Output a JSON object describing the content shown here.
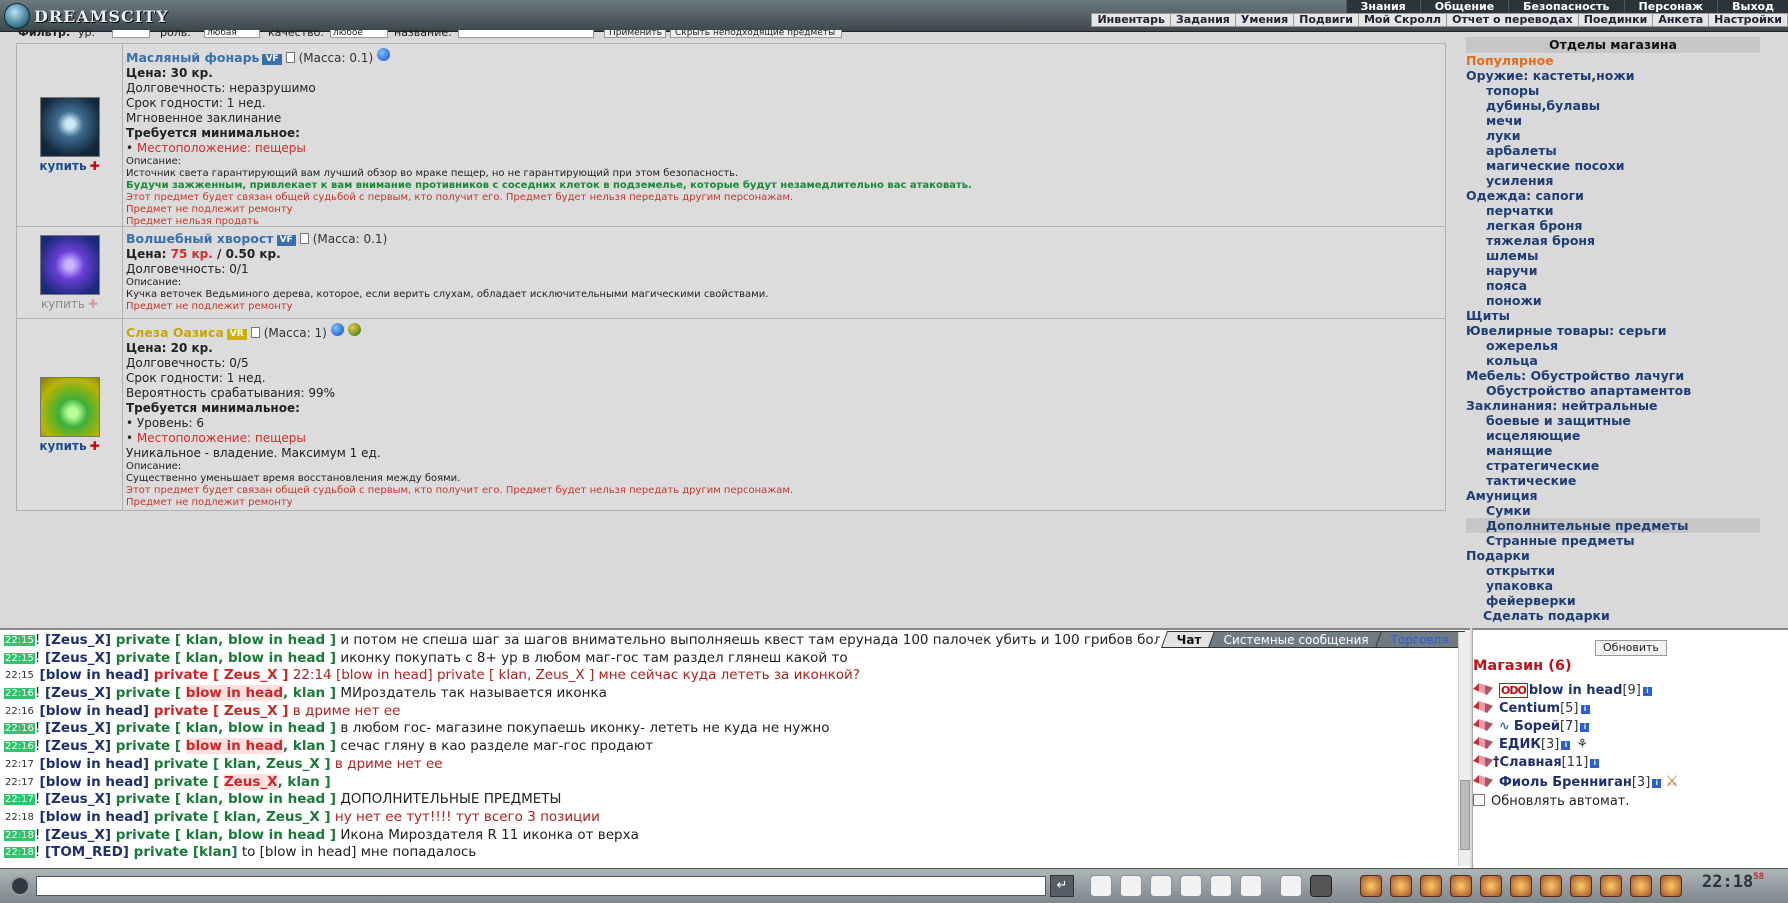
{
  "logo": "DREAMSCITY",
  "main_menu": [
    "Знания",
    "Общение",
    "Безопасность",
    "Персонаж",
    "Выход"
  ],
  "sub_menu": [
    "Инвентарь",
    "Задания",
    "Умения",
    "Подвиги",
    "Мой Скролл",
    "Отчет о переводах",
    "Поединки",
    "Анкета",
    "Настройки"
  ],
  "filter": {
    "fragments": [
      "Фильтр:",
      "ур.",
      "роль:",
      "качество:",
      "название:"
    ],
    "role_value": "любая",
    "quality_value": "любое",
    "apply": "Применить",
    "hide": "Скрыть неподходящие предметы"
  },
  "items": [
    {
      "name": "Масляный фонарь",
      "badge": "VF",
      "mass": "(Масса: 0.1)",
      "price_label": "Цена:",
      "price": "30 кр.",
      "lines": [
        "Долговечность: неразрушимо",
        "Срок годности: 1 нед.",
        "Мгновенное заклинание"
      ],
      "req_title": "Требуется минимальное:",
      "req": [
        "Местоположение: пещеры"
      ],
      "desc_label": "Описание:",
      "desc": "Источник света гарантирующий вам лучший обзор во мраке пещер, но не гарантирующий при этом безопасность.",
      "green": "Будучи зажженным, привлекает к вам внимание противников с соседних клеток в подземелье, которые будут незамедлительно вас атаковать.",
      "warnings": [
        "Этот предмет будет связан общей судьбой с первым, кто получит его. Предмет будет нельзя передать другим персонажам.",
        "Предмет не подлежит ремонту",
        "Предмет нельзя продать"
      ],
      "buy": "купить"
    },
    {
      "name": "Волшебный хворост",
      "badge": "VF",
      "mass": "(Масса: 0.1)",
      "price_label": "Цена:",
      "price_red": "75 кр.",
      "price_extra": "/ 0.50 кр.",
      "lines": [
        "Долговечность: 0/1"
      ],
      "desc_label": "Описание:",
      "desc": "Кучка веточек Ведьминого дерева, которое, если верить слухам, обладает исключительными магическими свойствами.",
      "warnings": [
        "Предмет не подлежит ремонту"
      ],
      "buy": "купить"
    },
    {
      "name": "Слеза Оазиса",
      "badge": "VR",
      "mass": "(Масса: 1)",
      "price_label": "Цена:",
      "price": "20 кр.",
      "lines": [
        "Долговечность: 0/5",
        "Срок годности: 1 нед.",
        "Вероятность срабатывания: 99%"
      ],
      "req_title": "Требуется минимальное:",
      "req_plain": "• Уровень: 6",
      "req": [
        "Местоположение: пещеры"
      ],
      "extra": "Уникальное - владение. Максимум 1 ед.",
      "desc_label": "Описание:",
      "desc": "Существенно уменьшает время восстановления между боями.",
      "warnings": [
        "Этот предмет будет связан общей судьбой с первым, кто получит его. Предмет будет нельзя передать другим персонажам.",
        "Предмет не подлежит ремонту"
      ],
      "buy": "купить"
    }
  ],
  "shop_sections": {
    "title": "Отделы магазина",
    "entries": [
      {
        "t": "cat pop",
        "l": "Популярное"
      },
      {
        "t": "cat",
        "l": "Оружие: кастеты,ножи"
      },
      {
        "t": "sub",
        "l": "топоры"
      },
      {
        "t": "sub",
        "l": "дубины,булавы"
      },
      {
        "t": "sub",
        "l": "мечи"
      },
      {
        "t": "sub",
        "l": "луки"
      },
      {
        "t": "sub",
        "l": "арбалеты"
      },
      {
        "t": "sub",
        "l": "магические посохи"
      },
      {
        "t": "sub",
        "l": "усиления"
      },
      {
        "t": "cat",
        "l": "Одежда: сапоги"
      },
      {
        "t": "sub",
        "l": "перчатки"
      },
      {
        "t": "sub",
        "l": "легкая броня"
      },
      {
        "t": "sub",
        "l": "тяжелая броня"
      },
      {
        "t": "sub",
        "l": "шлемы"
      },
      {
        "t": "sub",
        "l": "наручи"
      },
      {
        "t": "sub",
        "l": "пояса"
      },
      {
        "t": "sub",
        "l": "поножи"
      },
      {
        "t": "cat",
        "l": "Щиты"
      },
      {
        "t": "cat",
        "l": "Ювелирные товары: серьги"
      },
      {
        "t": "sub",
        "l": "ожерелья"
      },
      {
        "t": "sub",
        "l": "кольца"
      },
      {
        "t": "cat",
        "l": "Мебель: Обустройство лачуги"
      },
      {
        "t": "sub",
        "l": "Обустройство апартаментов"
      },
      {
        "t": "cat",
        "l": "Заклинания: нейтральные"
      },
      {
        "t": "sub",
        "l": "боевые и защитные"
      },
      {
        "t": "sub",
        "l": "исцеляющие"
      },
      {
        "t": "sub",
        "l": "манящие"
      },
      {
        "t": "sub",
        "l": "стратегические"
      },
      {
        "t": "sub",
        "l": "тактические"
      },
      {
        "t": "cat",
        "l": "Амуниция"
      },
      {
        "t": "sub",
        "l": "Сумки"
      },
      {
        "t": "sub sel",
        "l": "Дополнительные предметы"
      },
      {
        "t": "sub",
        "l": "Странные предметы"
      },
      {
        "t": "cat",
        "l": "Подарки"
      },
      {
        "t": "sub",
        "l": "открытки"
      },
      {
        "t": "sub",
        "l": "упаковка"
      },
      {
        "t": "sub",
        "l": "фейерверки"
      },
      {
        "t": "gift",
        "l": "Сделать подарки"
      }
    ]
  },
  "chat_tabs": [
    "Чат",
    "Системные сообщения",
    "Торговля"
  ],
  "chat": [
    {
      "ts": "22:15",
      "hi": true,
      "parts": [
        [
          "!",
          ""
        ],
        [
          " [Zeus_X]",
          "nm"
        ],
        [
          " private [ klan, blow in head ]",
          "pv"
        ],
        [
          " и потом не спеша шаг за шагов внимательно выполняешь квест там ерунада 100 палочек убить и 100 грибов бол",
          ""
        ]
      ]
    },
    {
      "ts": "22:15",
      "hi": true,
      "parts": [
        [
          "!",
          ""
        ],
        [
          " [Zeus_X]",
          "nm"
        ],
        [
          " private [ klan, blow in head ]",
          "pv"
        ],
        [
          " иконку покупать с 8+ ур в любом маг-гос там раздел глянеш какой то",
          ""
        ]
      ]
    },
    {
      "ts": "22:15",
      "hi": false,
      "parts": [
        [
          " [blow in head]",
          "nm"
        ],
        [
          " private [ Zeus_X ]",
          "pvr"
        ],
        [
          " 22:14 [blow in head] private [ klan, Zeus_X ] мне сейчас куда лететь за иконкой?",
          "red"
        ]
      ]
    },
    {
      "ts": "22:16",
      "hi": true,
      "parts": [
        [
          "!",
          ""
        ],
        [
          " [Zeus_X]",
          "nm"
        ],
        [
          " private [ ",
          "pv"
        ],
        [
          "blow in head",
          "me-hl"
        ],
        [
          ", klan ]",
          "pv"
        ],
        [
          " МИроздатель так называется иконка",
          ""
        ]
      ]
    },
    {
      "ts": "22:16",
      "hi": false,
      "parts": [
        [
          " [blow in head]",
          "nm"
        ],
        [
          " private [ Zeus_X ]",
          "pvr"
        ],
        [
          " в дриме нет ее",
          "red"
        ]
      ]
    },
    {
      "ts": "22:16",
      "hi": true,
      "parts": [
        [
          "!",
          ""
        ],
        [
          " [Zeus_X]",
          "nm"
        ],
        [
          " private [ klan, blow in head ]",
          "pv"
        ],
        [
          " в любом гос- магазине покупаешь иконку- лететь не куда не нужно",
          ""
        ]
      ]
    },
    {
      "ts": "22:16",
      "hi": true,
      "parts": [
        [
          "!",
          ""
        ],
        [
          " [Zeus_X]",
          "nm"
        ],
        [
          " private [ ",
          "pv"
        ],
        [
          "blow in head",
          "me-hl"
        ],
        [
          ", klan ]",
          "pv"
        ],
        [
          " сечас гляну в као разделе маг-гос продают",
          ""
        ]
      ]
    },
    {
      "ts": "22:17",
      "hi": false,
      "parts": [
        [
          " [blow in head]",
          "nm"
        ],
        [
          " private [ klan, Zeus_X ]",
          "pv"
        ],
        [
          " в дриме нет ее",
          "red"
        ]
      ]
    },
    {
      "ts": "22:17",
      "hi": false,
      "parts": [
        [
          " [blow in head]",
          "nm"
        ],
        [
          " private [ ",
          "pv"
        ],
        [
          "Zeus_X",
          "me-hl"
        ],
        [
          ", klan ]",
          "pv"
        ]
      ]
    },
    {
      "ts": "22:17",
      "hi": true,
      "parts": [
        [
          "!",
          ""
        ],
        [
          " [Zeus_X]",
          "nm"
        ],
        [
          " private [ klan, blow in head ]",
          "pv"
        ],
        [
          " ДОПОЛНИТЕЛЬНЫЕ ПРЕДМЕТЫ",
          ""
        ]
      ]
    },
    {
      "ts": "22:18",
      "hi": false,
      "parts": [
        [
          " [blow in head]",
          "nm"
        ],
        [
          " private [ klan, Zeus_X ]",
          "pv"
        ],
        [
          " ну нет ее тут!!!! тут всего 3 позиции",
          "red"
        ]
      ]
    },
    {
      "ts": "22:18",
      "hi": true,
      "parts": [
        [
          "!",
          ""
        ],
        [
          " [Zeus_X]",
          "nm"
        ],
        [
          " private [ klan, blow in head ]",
          "pv"
        ],
        [
          " Икона Мироздателя R 11 иконка от верха",
          ""
        ]
      ]
    },
    {
      "ts": "22:18",
      "hi": true,
      "parts": [
        [
          "!",
          ""
        ],
        [
          " [TOM_RED]",
          "nm"
        ],
        [
          " private [klan]",
          "pv"
        ],
        [
          " to [blow in head] мне попадалось",
          ""
        ]
      ]
    }
  ],
  "shop_panel": {
    "refresh": "Обновить",
    "title": "Магазин (6)",
    "users": [
      {
        "tag": "ODO",
        "name": "blow in head",
        "lvl": "[9]"
      },
      {
        "name": "Centium",
        "lvl": "[5]"
      },
      {
        "name": "Борей",
        "lvl": "[7]"
      },
      {
        "name": "ЕДИК",
        "lvl": "[3]"
      },
      {
        "name": "Славная",
        "lvl": "[11]"
      },
      {
        "name": "Фиоль Бренниган",
        "lvl": "[3]"
      }
    ],
    "auto": "Обновлять автомат."
  },
  "clock": {
    "time": "22:18",
    "sec": "58"
  },
  "colors": {
    "accent": "#3b6fa8",
    "timestamp_green": "#31c46c",
    "private_green": "#1a7a3a",
    "shop_title_red": "#c0121a"
  }
}
